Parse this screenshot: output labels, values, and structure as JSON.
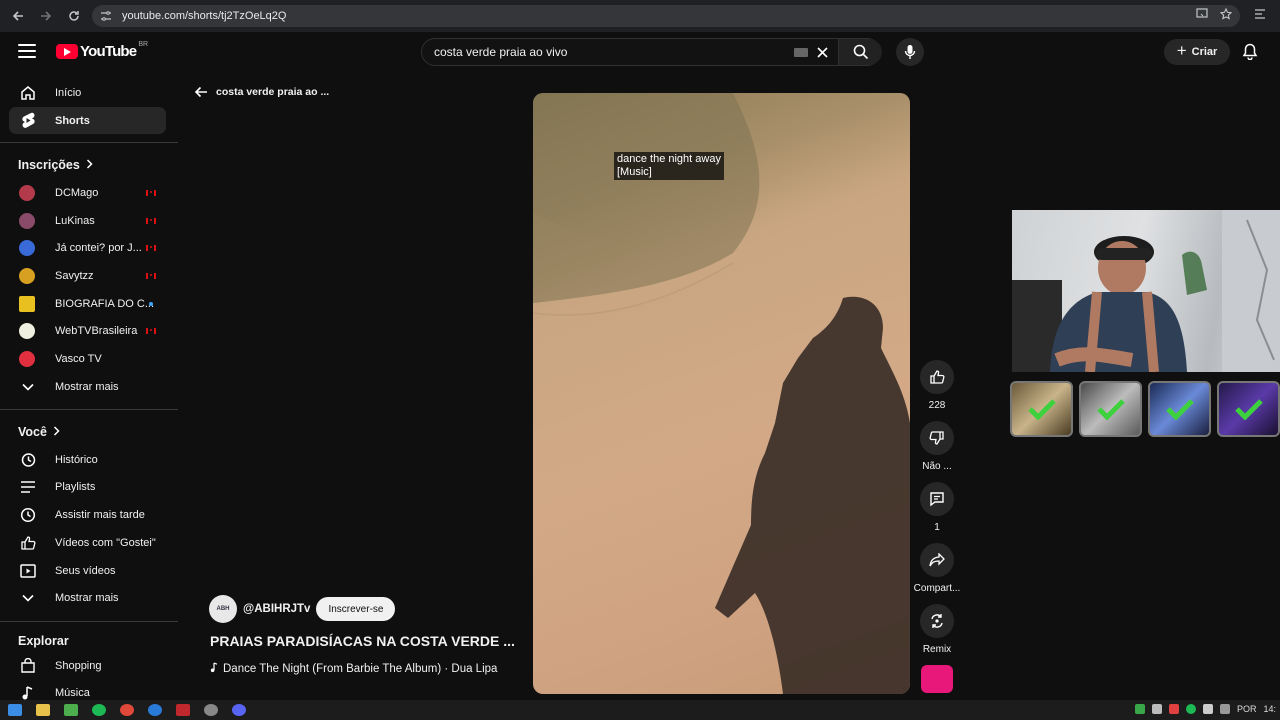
{
  "browser": {
    "url": "youtube.com/shorts/tj2TzOeLq2Q"
  },
  "header": {
    "logo_text": "YouTube",
    "logo_country": "BR",
    "search_value": "costa verde praia ao vivo",
    "create_label": "Criar"
  },
  "sidebar": {
    "main": [
      {
        "label": "Início",
        "icon": "home-icon"
      },
      {
        "label": "Shorts",
        "icon": "shorts-icon"
      }
    ],
    "subscriptions_title": "Inscrições",
    "subscriptions": [
      {
        "label": "DCMago",
        "color": "#b23a4a",
        "status": "live"
      },
      {
        "label": "LuKinas",
        "color": "#8a4a6a",
        "status": "live"
      },
      {
        "label": "Já contei? por J...",
        "color": "#3a6ad8",
        "status": "live"
      },
      {
        "label": "Savytzz",
        "color": "#d8a020",
        "status": "live"
      },
      {
        "label": "BIOGRAFIA DO C...",
        "color": "#e8c020",
        "status": "new"
      },
      {
        "label": "WebTVBrasileira",
        "color": "#f0f0e0",
        "status": "live"
      },
      {
        "label": "Vasco TV",
        "color": "#e03040",
        "status": "none"
      }
    ],
    "show_more": "Mostrar mais",
    "you_title": "Você",
    "you_items": [
      {
        "label": "Histórico",
        "icon": "history-icon"
      },
      {
        "label": "Playlists",
        "icon": "playlists-icon"
      },
      {
        "label": "Assistir mais tarde",
        "icon": "watch-later-icon"
      },
      {
        "label": "Vídeos com \"Gostei\"",
        "icon": "liked-videos-icon"
      },
      {
        "label": "Seus vídeos",
        "icon": "your-videos-icon"
      }
    ],
    "show_more_2": "Mostrar mais",
    "explore_title": "Explorar",
    "explore_items": [
      {
        "label": "Shopping",
        "icon": "shopping-icon"
      },
      {
        "label": "Música",
        "icon": "music-icon"
      }
    ]
  },
  "short": {
    "back_label": "costa verde praia ao ...",
    "caption_line1": "dance the night away",
    "caption_line2": "[Music]",
    "channel_avatar_text": "ABH",
    "channel": "@ABIHRJTv",
    "subscribe": "Inscrever-se",
    "title": "PRAIAS PARADISÍACAS NA COSTA VERDE ...",
    "music": "Dance The Night (From Barbie The Album) · Dua Lipa",
    "actions": {
      "like_count": "228",
      "dislike": "Não ...",
      "comments": "1",
      "share": "Compart...",
      "remix": "Remix"
    }
  },
  "taskbar": {
    "lang": "POR",
    "time": "14:"
  },
  "colors": {
    "accent_red": "#ff0033",
    "check_green": "#3ed13e"
  }
}
